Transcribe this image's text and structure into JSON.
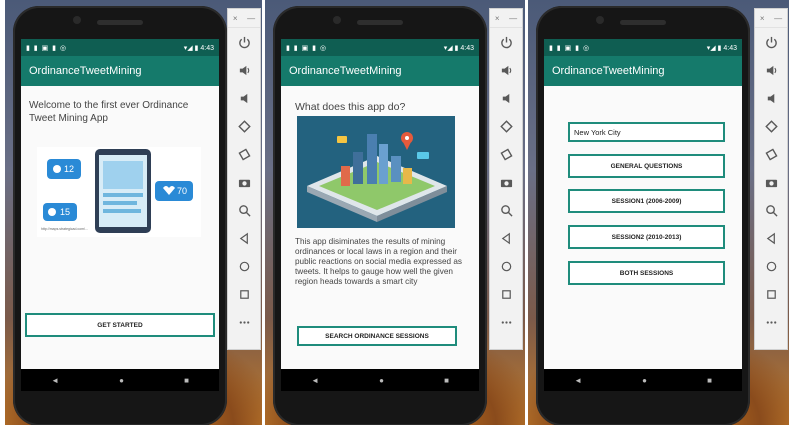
{
  "status": {
    "left_icons": "▮ ▮ ▣ ▮ ◎",
    "right_icons": "▾◢ ▮",
    "time": "4:43"
  },
  "app": {
    "title": "OrdinanceTweetMining"
  },
  "screen1": {
    "welcome": "Welcome to the first ever Ordinance Tweet Mining App",
    "badge_comments": "12",
    "badge_likes": "15",
    "badge_hearts": "70",
    "caption": "http://maps.strategicad.com/...",
    "cta": "GET STARTED"
  },
  "screen2": {
    "heading": "What does this app do?",
    "description": "This app disiminates the results of mining ordinances or local laws in a region and their public reactions on social media expressed as tweets. It helps to gauge how well the given region heads towards a smart city",
    "cta": "SEARCH ORDINANCE SESSIONS"
  },
  "screen3": {
    "city_value": "New York City",
    "buttons": [
      "GENERAL QUESTIONS",
      "SESSION1 (2006-2009)",
      "SESSION2 (2010-2013)",
      "BOTH SESSIONS"
    ]
  },
  "emulator": {
    "close": "×",
    "minimize": "—"
  },
  "nav": {
    "back": "◄",
    "home": "●",
    "recents": "■"
  },
  "colors": {
    "accent": "#1f8c7c",
    "appbar": "#157a6b",
    "statusbar": "#0f5e52"
  }
}
